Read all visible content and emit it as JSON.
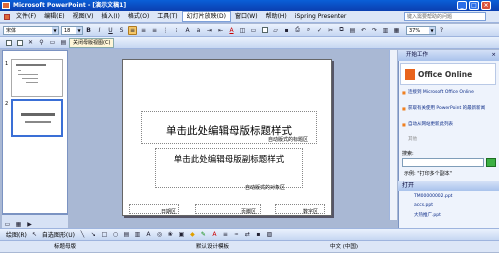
{
  "window": {
    "title": "Microsoft PowerPoint - [演示文稿1]"
  },
  "menu": {
    "items": [
      "文件(F)",
      "编辑(E)",
      "视图(V)",
      "插入(I)",
      "格式(O)",
      "工具(T)",
      "幻灯片放映(D)",
      "窗口(W)",
      "帮助(H)",
      "iSpring Presenter"
    ],
    "help_placeholder": "键入需要帮助的问题"
  },
  "toolbar1": {
    "font": "宋体",
    "size": "18",
    "zoom": "37%"
  },
  "toolbar2": {
    "close_master": "关闭母版视图(C)"
  },
  "outline": {
    "slide_numbers": [
      "1",
      "2"
    ]
  },
  "slide": {
    "title_placeholder": "单击此处编辑母版标题样式",
    "title_area_label": "自动版式的标题区",
    "subtitle_placeholder": "单击此处编辑母版副标题样式",
    "object_area_label": "自动版式的对象区",
    "date_label": "日期区",
    "footer_label": "页脚区",
    "number_label": "数字区"
  },
  "taskpane": {
    "title": "开始工作",
    "logo": "Office Online",
    "links": [
      "连接到 Microsoft Office Online",
      "获取有关使用 PowerPoint 的最新新闻",
      "自动从网站更新此列表"
    ],
    "more": "其他",
    "search_label": "搜索:",
    "example": "示例: \"打印多个副本\"",
    "open_title": "打开",
    "recent_files": [
      "TM00000002.ppt",
      "accs.ppt",
      "大热推广.ppt"
    ]
  },
  "drawbar": {
    "draw": "绘图(R)",
    "autoshapes": "自选图形(U)"
  },
  "status": {
    "master": "标题母版",
    "design": "默认设计模板",
    "lang": "中文 (中国)"
  }
}
